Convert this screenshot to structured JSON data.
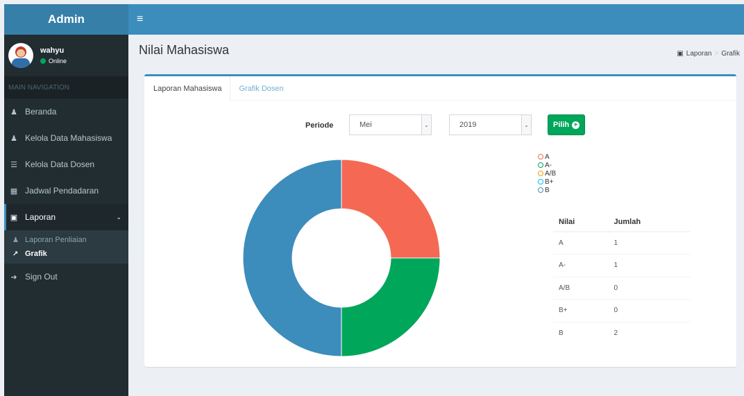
{
  "app": {
    "brand": "Admin"
  },
  "user": {
    "name": "wahyu",
    "status": "Online"
  },
  "sidebar": {
    "header": "MAIN NAVIGATION",
    "items": [
      {
        "label": "Beranda",
        "icon": "user-icon"
      },
      {
        "label": "Kelola Data Mahasiswa",
        "icon": "users-icon"
      },
      {
        "label": "Kelola Data Dosen",
        "icon": "list-icon"
      },
      {
        "label": "Jadwal Pendadaran",
        "icon": "calendar-icon"
      },
      {
        "label": "Laporan",
        "icon": "book-icon"
      }
    ],
    "submenu": [
      {
        "label": "Laporan Penliaian",
        "icon": "users-icon"
      },
      {
        "label": "Grafik",
        "icon": "line-chart-icon"
      }
    ],
    "signout": "Sign Out"
  },
  "page": {
    "title": "Nilai Mahasiswa",
    "breadcrumb": [
      "Laporan",
      "Grafik"
    ]
  },
  "tabs": [
    "Laporan Mahasiswa",
    "Grafik Dosen"
  ],
  "filter": {
    "label": "Periode",
    "month": "Mei",
    "year": "2019",
    "button": "Pilih"
  },
  "table": {
    "headers": [
      "Nilai",
      "Jumlah"
    ],
    "rows": [
      [
        "A",
        "1"
      ],
      [
        "A-",
        "1"
      ],
      [
        "A/B",
        "0"
      ],
      [
        "B+",
        "0"
      ],
      [
        "B",
        "2"
      ]
    ]
  },
  "colors": {
    "A": "#f56954",
    "A-": "#00a65a",
    "A/B": "#f39c12",
    "B+": "#00c0ef",
    "B": "#3c8dbc"
  },
  "chart_data": {
    "type": "pie",
    "categories": [
      "A",
      "A-",
      "A/B",
      "B+",
      "B"
    ],
    "values": [
      1,
      1,
      0,
      0,
      2
    ],
    "legend": "top-right"
  }
}
